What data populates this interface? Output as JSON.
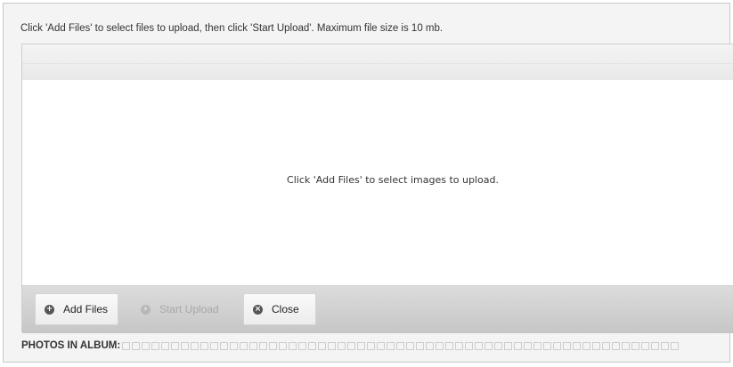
{
  "instructions": "Click 'Add Files' to select files to upload, then click 'Start Upload'. Maximum file size is 10 mb.",
  "file_area": {
    "empty_message": "Click 'Add Files' to select images to upload."
  },
  "toolbar": {
    "add_label": "Add Files",
    "add_icon": "plus-circle-icon",
    "start_label": "Start Upload",
    "start_icon": "arrow-circle-icon",
    "start_enabled": false,
    "close_label": "Close",
    "close_icon": "x-circle-icon"
  },
  "album": {
    "label": "PHOTOS IN ALBUM:",
    "filled_count": 0,
    "slot_count": 57
  },
  "colors": {
    "panel_bg": "#f4f4f4",
    "toolbar_bg": "#cfcfcf",
    "icon_dark": "#555555",
    "icon_disabled": "#b8b8b8"
  }
}
